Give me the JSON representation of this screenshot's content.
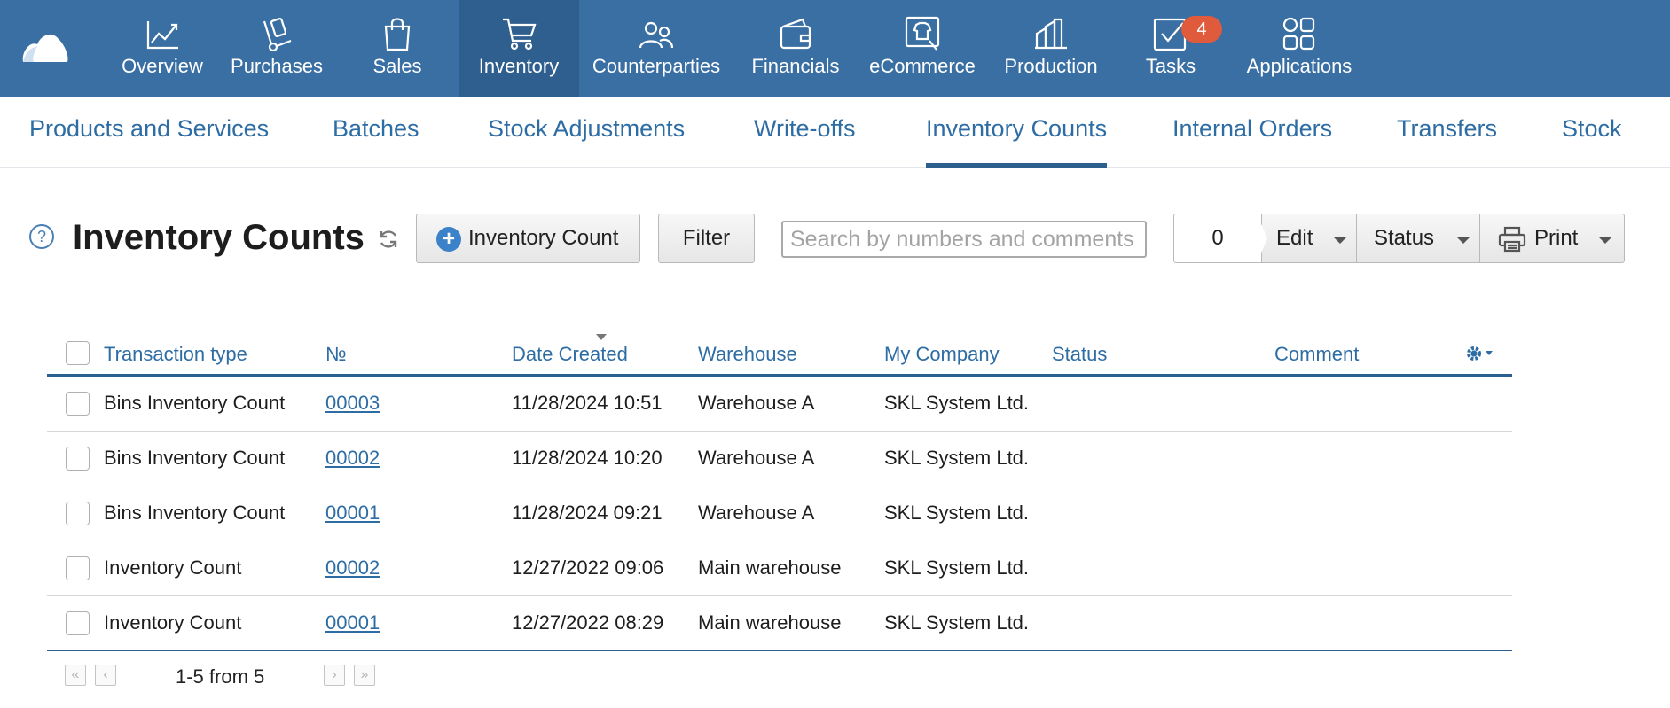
{
  "nav": {
    "items": [
      {
        "label": "Overview",
        "icon": "chart-line-icon"
      },
      {
        "label": "Purchases",
        "icon": "hand-truck-icon"
      },
      {
        "label": "Sales",
        "icon": "shopping-bag-icon"
      },
      {
        "label": "Inventory",
        "icon": "cart-icon",
        "active": true
      },
      {
        "label": "Counterparties",
        "icon": "people-icon"
      },
      {
        "label": "Financials",
        "icon": "wallet-icon"
      },
      {
        "label": "eCommerce",
        "icon": "storefront-icon"
      },
      {
        "label": "Production",
        "icon": "factory-icon"
      },
      {
        "label": "Tasks",
        "icon": "checkbox-icon",
        "badge": "4"
      },
      {
        "label": "Applications",
        "icon": "apps-grid-icon"
      }
    ],
    "colors": {
      "background": "#3a6fa3",
      "active": "#2f5f8f",
      "badge": "#e05a3c"
    }
  },
  "subtabs": [
    {
      "label": "Products and Services"
    },
    {
      "label": "Batches"
    },
    {
      "label": "Stock Adjustments"
    },
    {
      "label": "Write-offs"
    },
    {
      "label": "Inventory Counts",
      "active": true
    },
    {
      "label": "Internal Orders"
    },
    {
      "label": "Transfers"
    },
    {
      "label": "Stock"
    }
  ],
  "toolbar": {
    "help_label": "?",
    "title": "Inventory Counts",
    "add_label": "Inventory Count",
    "filter_label": "Filter",
    "search_placeholder": "Search by numbers and comments",
    "selected_count": "0",
    "edit_label": "Edit",
    "status_label": "Status",
    "print_label": "Print"
  },
  "table": {
    "columns": [
      "Transaction type",
      "№",
      "Date Created",
      "Warehouse",
      "My Company",
      "Status",
      "Comment"
    ],
    "rows": [
      {
        "type": "Bins Inventory Count",
        "number": "00003",
        "date": "11/28/2024 10:51",
        "warehouse": "Warehouse A",
        "company": "SKL System Ltd.",
        "status": "",
        "comment": ""
      },
      {
        "type": "Bins Inventory Count",
        "number": "00002",
        "date": "11/28/2024 10:20",
        "warehouse": "Warehouse A",
        "company": "SKL System Ltd.",
        "status": "",
        "comment": ""
      },
      {
        "type": "Bins Inventory Count",
        "number": "00001",
        "date": "11/28/2024 09:21",
        "warehouse": "Warehouse A",
        "company": "SKL System Ltd.",
        "status": "",
        "comment": ""
      },
      {
        "type": "Inventory Count",
        "number": "00002",
        "date": "12/27/2022 09:06",
        "warehouse": "Main warehouse",
        "company": "SKL System Ltd.",
        "status": "",
        "comment": ""
      },
      {
        "type": "Inventory Count",
        "number": "00001",
        "date": "12/27/2022 08:29",
        "warehouse": "Main warehouse",
        "company": "SKL System Ltd.",
        "status": "",
        "comment": ""
      }
    ]
  },
  "pager": {
    "range_text": "1-5 from 5",
    "first_glyph": "«",
    "prev_glyph": "‹",
    "next_glyph": "›",
    "last_glyph": "»"
  }
}
